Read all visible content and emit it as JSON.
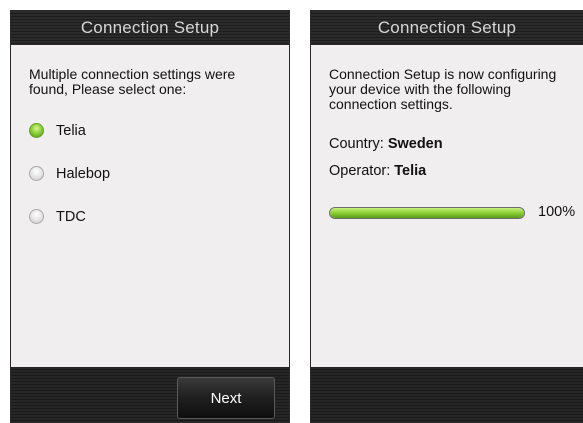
{
  "left_screen": {
    "title": "Connection Setup",
    "intro": "Multiple connection settings were found, Please select one:",
    "options": [
      {
        "label": "Telia",
        "checked": true
      },
      {
        "label": "Halebop",
        "checked": false
      },
      {
        "label": "TDC",
        "checked": false
      }
    ],
    "next_label": "Next"
  },
  "right_screen": {
    "title": "Connection Setup",
    "info": "Connection Setup is now configuring your device with the following connection settings.",
    "country_label": "Country:",
    "country_value": "Sweden",
    "operator_label": "Operator:",
    "operator_value": "Telia",
    "progress_value": 100,
    "progress_text": "100%"
  },
  "colors": {
    "accent_green": "#8ccf33",
    "titlebar": "#2b2b2b",
    "screen_background": "#f1eef0"
  }
}
